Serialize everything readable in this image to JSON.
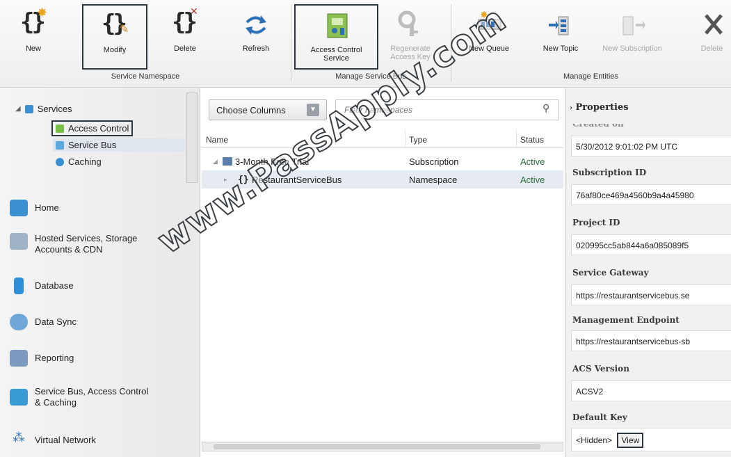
{
  "ribbon": {
    "groups": [
      {
        "label": "Service Namespace"
      },
      {
        "label": "Manage Service Bus"
      },
      {
        "label": "Manage Entities"
      }
    ],
    "buttons": {
      "new": "New",
      "modify": "Modify",
      "delete": "Delete",
      "refresh": "Refresh",
      "acs_line1": "Access Control",
      "acs_line2": "Service",
      "regen_line1": "Regenerate",
      "regen_line2": "Access Key",
      "new_queue": "New Queue",
      "new_topic": "New Topic",
      "new_subscription": "New Subscription",
      "delete2": "Delete"
    }
  },
  "tree": {
    "services": "Services",
    "access_control": "Access Control",
    "service_bus": "Service Bus",
    "caching": "Caching"
  },
  "nav": {
    "home": "Home",
    "hosted_line1": "Hosted Services, Storage",
    "hosted_line2": "Accounts & CDN",
    "database": "Database",
    "data_sync": "Data Sync",
    "reporting": "Reporting",
    "sb_line1": "Service Bus, Access Control",
    "sb_line2": "& Caching",
    "virtual_network": "Virtual Network"
  },
  "grid": {
    "choose_columns": "Choose Columns",
    "filter_placeholder": "Filter namespaces",
    "headers": {
      "name": "Name",
      "type": "Type",
      "status": "Status"
    },
    "rows": [
      {
        "name": "3-Month Free Trial",
        "type": "Subscription",
        "status": "Active"
      },
      {
        "name": "RestaurantServiceBus",
        "type": "Namespace",
        "status": "Active"
      }
    ]
  },
  "properties": {
    "title": "Properties",
    "created_label": "Created on",
    "created": "5/30/2012 9:01:02 PM UTC",
    "subscription_label": "Subscription ID",
    "subscription": "76af80ce469a4560b9a4a45980",
    "project_label": "Project ID",
    "project": "020995cc5ab844a6a085089f5",
    "gateway_label": "Service Gateway",
    "gateway": "https://restaurantservicebus.se",
    "mgmt_label": "Management Endpoint",
    "mgmt": "https://restaurantservicebus-sb",
    "acs_label": "ACS Version",
    "acs": "ACSV2",
    "key_label": "Default Key",
    "key": "<Hidden>",
    "view": "View"
  },
  "watermark": "www.PassApply.com"
}
